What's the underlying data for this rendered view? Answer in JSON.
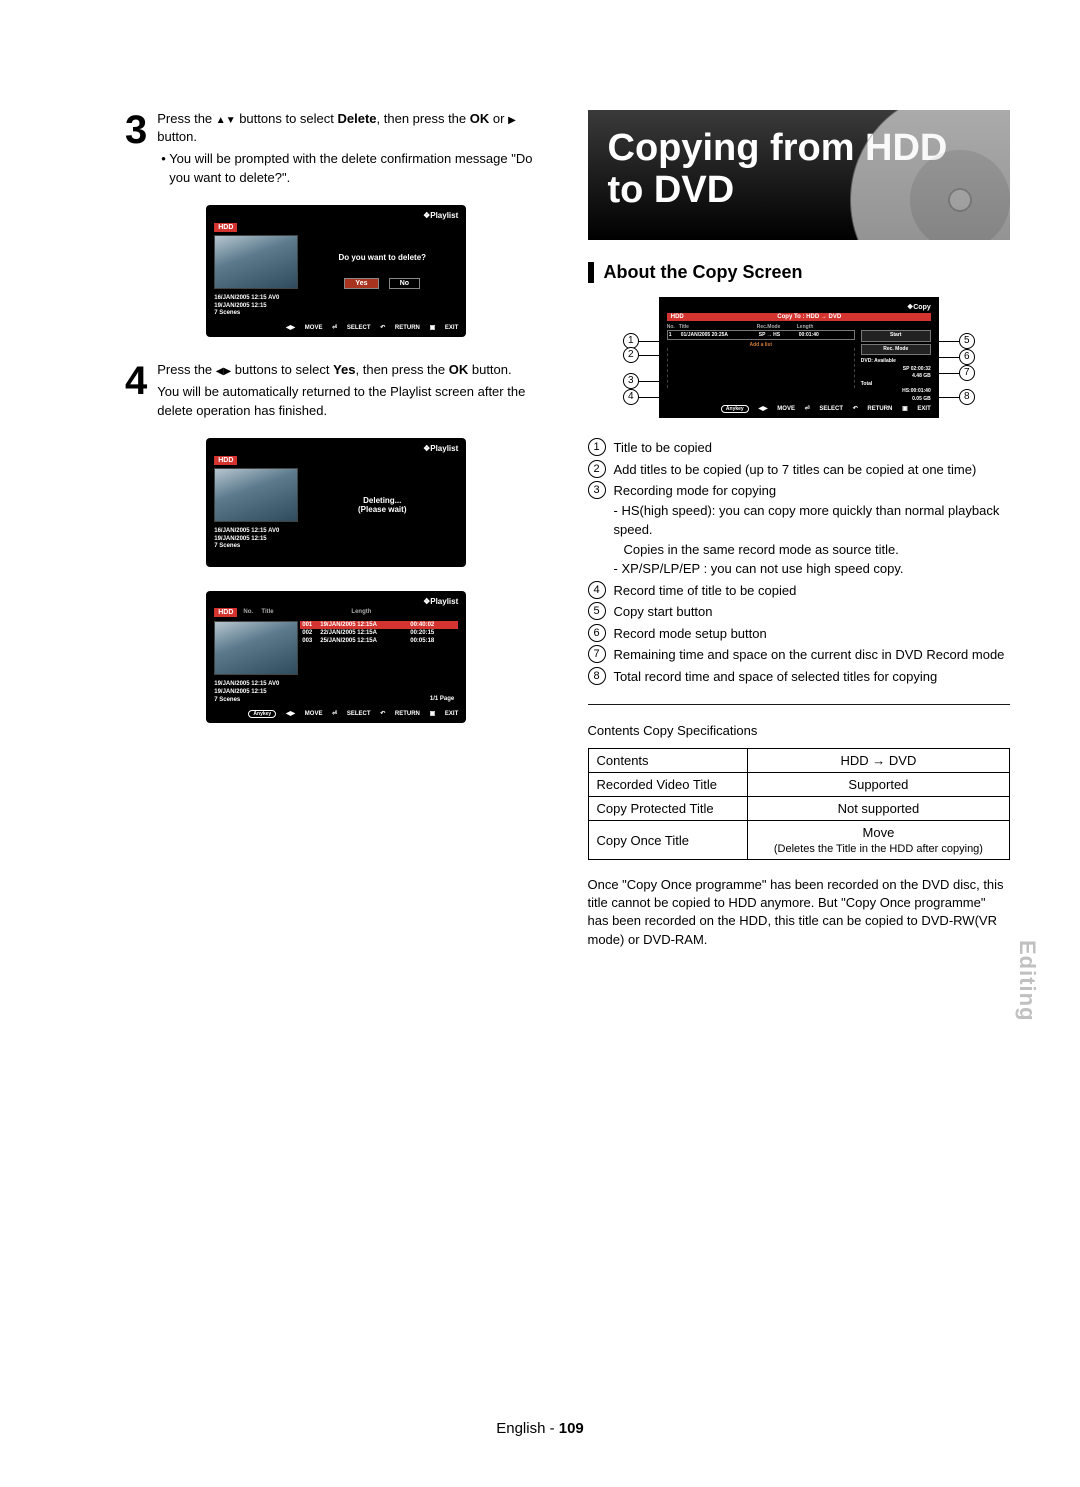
{
  "left": {
    "step3": {
      "num": "3",
      "pre": "Press the ",
      "mid1": " buttons to select ",
      "bold1": "Delete",
      "mid2": ", then press the ",
      "bold2": "OK",
      "mid3": " or ",
      "post": " button.",
      "bullet": "You will be prompted with the delete confirmation message \"Do you want to delete?\"."
    },
    "step4": {
      "num": "4",
      "pre": "Press the ",
      "mid1": " buttons to select ",
      "bold1": "Yes",
      "mid2": ", then press the ",
      "bold2": "OK",
      "mid3": " button.",
      "after": "You will be automatically returned to the Playlist screen after the delete operation has finished."
    },
    "ss1": {
      "head": "Playlist",
      "hdd": "HDD",
      "prompt": "Do you want to delete?",
      "yes": "Yes",
      "no": "No",
      "line1": "16/JAN/2005 12:15 AV0",
      "line2": "19/JAN/2005 12:15",
      "line3": "7 Scenes",
      "foot_move": "MOVE",
      "foot_select": "SELECT",
      "foot_return": "RETURN",
      "foot_exit": "EXIT"
    },
    "ss2": {
      "head": "Playlist",
      "hdd": "HDD",
      "status1": "Deleting...",
      "status2": "(Please wait)",
      "line1": "16/JAN/2005 12:15 AV0",
      "line2": "19/JAN/2005 12:15",
      "line3": "7 Scenes"
    },
    "ss3": {
      "head": "Playlist",
      "hdd": "HDD",
      "cols": {
        "no": "No.",
        "title": "Title",
        "length": "Length"
      },
      "rows": [
        [
          "001",
          "19/JAN/2005 12:15A",
          "00:40:02"
        ],
        [
          "002",
          "22/JAN/2005 12:15A",
          "00:20:15"
        ],
        [
          "003",
          "25/JAN/2005 12:15A",
          "00:05:18"
        ]
      ],
      "line1": "19/JAN/2005 12:15 AV0",
      "line2": "19/JAN/2005 12:15",
      "line3": "7 Scenes",
      "page": "1/1 Page",
      "foot_anykey": "Anykey",
      "foot_move": "MOVE",
      "foot_select": "SELECT",
      "foot_return": "RETURN",
      "foot_exit": "EXIT"
    }
  },
  "right": {
    "title": "Copying from HDD to DVD",
    "section": "About the Copy Screen",
    "copyScreen": {
      "head": "Copy",
      "hdd": "HDD",
      "copyto": "Copy To : HDD → DVD",
      "cols": {
        "no": "No.",
        "title": "Title",
        "recmode": "Rec.Mode",
        "length": "Length"
      },
      "row": {
        "no": "1",
        "title": "01/JAN/2005 20:25A",
        "mode": "SP → HS",
        "length": "00:01:40"
      },
      "addlist": "Add a list",
      "start": "Start",
      "rec_mode": "Rec. Mode",
      "dvd_avail": "DVD: Available",
      "sp": "SP  02:00:32",
      "gb1": "4.48 GB",
      "total": "Total",
      "hs": "HS:00:01:40",
      "gb2": "0.05 GB",
      "foot_anykey": "Anykey",
      "foot_move": "MOVE",
      "foot_select": "SELECT",
      "foot_return": "RETURN",
      "foot_exit": "EXIT"
    },
    "legend": {
      "i1": "Title to be copied",
      "i2": "Add titles to be copied (up to 7 titles can be copied at one time)",
      "i3": "Recording mode for copying",
      "i3a": "- HS(high speed): you can copy more quickly than normal playback speed.",
      "i3b": "Copies in the same record mode as source title.",
      "i3c": "- XP/SP/LP/EP : you can not use high speed copy.",
      "i4": "Record time of title to be copied",
      "i5": "Copy start button",
      "i6": "Record mode setup button",
      "i7": "Remaining time and space on the current disc in DVD Record mode",
      "i8": "Total record time and space of selected titles for copying"
    },
    "spec_title": "Contents Copy Specifications",
    "table": {
      "r1c1": "Contents",
      "r1c2": "HDD → DVD",
      "r2c1": "Recorded Video Title",
      "r2c2": "Supported",
      "r3c1": "Copy Protected Title",
      "r3c2": "Not supported",
      "r4c1": "Copy Once Title",
      "r4c2a": "Move",
      "r4c2b": "(Deletes the Title in the HDD after copying)"
    },
    "note": "Once \"Copy Once programme\" has been recorded on the DVD disc, this title cannot be copied to HDD anymore. But \"Copy Once programme\" has been recorded on the HDD, this title can be copied to DVD-RW(VR mode) or DVD-RAM.",
    "side_tab": "Editing",
    "footer_lang": "English - ",
    "footer_page": "109"
  }
}
